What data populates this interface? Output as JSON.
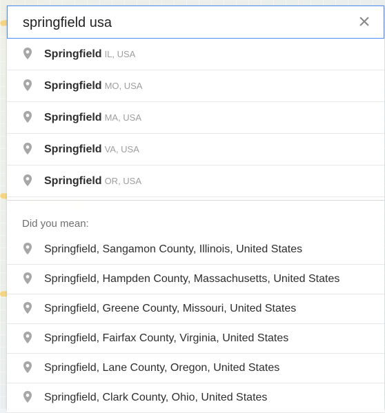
{
  "search": {
    "value": "springfield usa"
  },
  "suggestions": [
    {
      "name": "Springfield",
      "detail": "IL, USA"
    },
    {
      "name": "Springfield",
      "detail": "MO, USA"
    },
    {
      "name": "Springfield",
      "detail": "MA, USA"
    },
    {
      "name": "Springfield",
      "detail": "VA, USA"
    },
    {
      "name": "Springfield",
      "detail": "OR, USA"
    }
  ],
  "did_you_mean": {
    "label": "Did you mean:",
    "items": [
      {
        "text": "Springfield, Sangamon County, Illinois, United States"
      },
      {
        "text": "Springfield, Hampden County, Massachusetts, United States"
      },
      {
        "text": "Springfield, Greene County, Missouri, United States"
      },
      {
        "text": "Springfield, Fairfax County, Virginia, United States"
      },
      {
        "text": "Springfield, Lane County, Oregon, United States"
      },
      {
        "text": "Springfield, Clark County, Ohio, United States"
      }
    ]
  },
  "icons": {
    "clear": "close-icon",
    "location": "location-pin-icon"
  },
  "colors": {
    "search_border": "#4a8af4",
    "pin": "#a7a7a7",
    "primary_text": "#2d2d2d",
    "secondary_text": "#9e9e9e"
  }
}
